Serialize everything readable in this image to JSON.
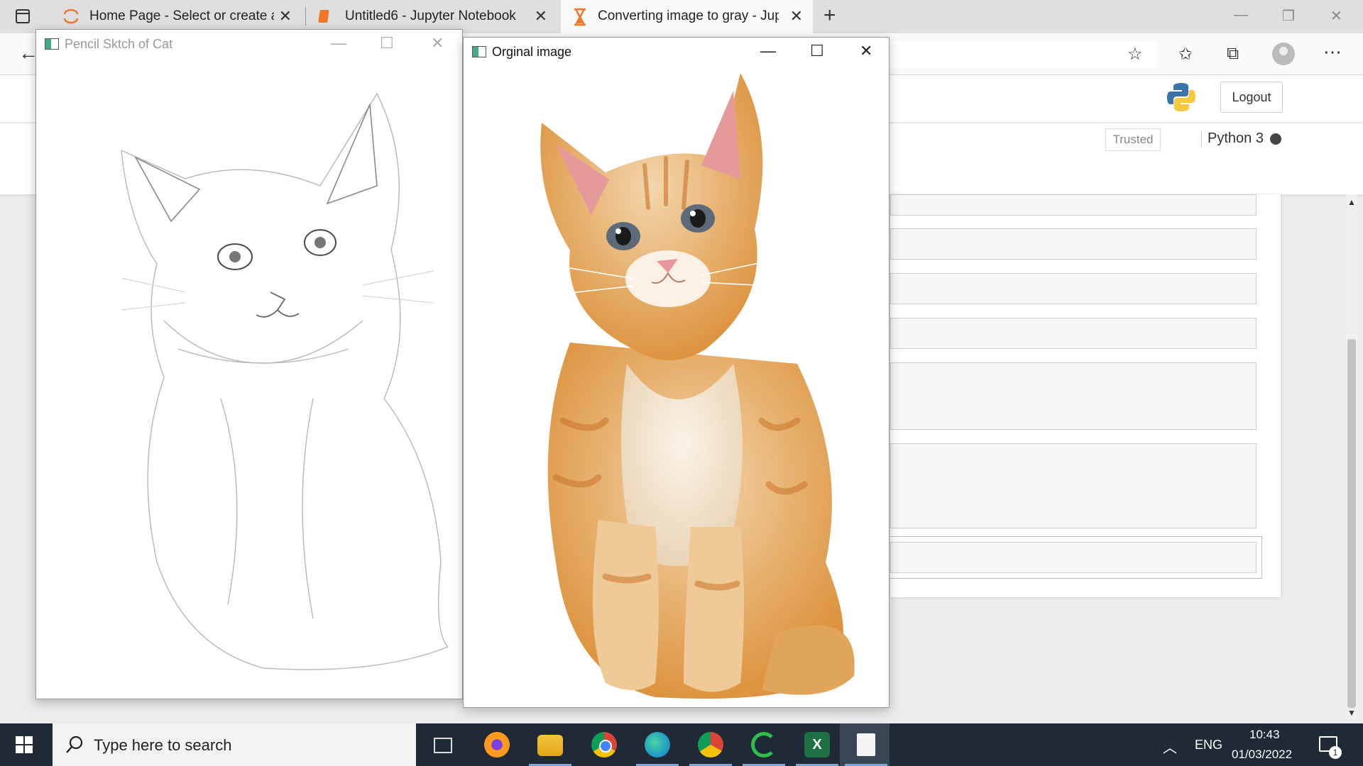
{
  "browser": {
    "tabs": [
      {
        "label": "Home Page - Select or create a n",
        "icon": "jupyter-icon"
      },
      {
        "label": "Untitled6 - Jupyter Notebook",
        "icon": "notebook-icon"
      },
      {
        "label": "Converting image to gray - Jupyt",
        "icon": "hourglass-icon",
        "active": true
      }
    ],
    "new_tab_glyph": "+"
  },
  "jupyter": {
    "logout_label": "Logout",
    "trusted_label": "Trusted",
    "kernel_name": "Python 3"
  },
  "windows": {
    "sketch": {
      "title": "Pencil Sktch of Cat"
    },
    "original": {
      "title": "Orginal image"
    }
  },
  "taskbar": {
    "search_placeholder": "Type here to search",
    "language": "ENG",
    "time": "10:43",
    "date": "01/03/2022",
    "notification_count": "1"
  },
  "colors": {
    "taskbar": "#1f2a36",
    "jupyter_orange": "#f37626",
    "cat_orange": "#e5a451"
  }
}
